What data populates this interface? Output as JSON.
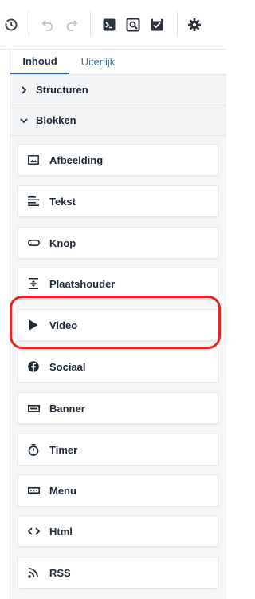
{
  "toolbar": {
    "icons": [
      "history-icon",
      "undo-icon",
      "redo-icon",
      "code-icon",
      "preview-icon",
      "save-icon",
      "settings-icon"
    ]
  },
  "tabs": [
    {
      "label": "Inhoud",
      "active": true
    },
    {
      "label": "Uiterlijk",
      "active": false
    }
  ],
  "sections": [
    {
      "label": "Structuren",
      "expanded": false
    },
    {
      "label": "Blokken",
      "expanded": true
    }
  ],
  "blocks": [
    {
      "label": "Afbeelding",
      "icon": "image-icon"
    },
    {
      "label": "Tekst",
      "icon": "text-icon"
    },
    {
      "label": "Knop",
      "icon": "button-icon"
    },
    {
      "label": "Plaatshouder",
      "icon": "spacer-icon"
    },
    {
      "label": "Video",
      "icon": "play-icon"
    },
    {
      "label": "Sociaal",
      "icon": "facebook-icon"
    },
    {
      "label": "Banner",
      "icon": "banner-icon"
    },
    {
      "label": "Timer",
      "icon": "timer-icon"
    },
    {
      "label": "Menu",
      "icon": "menu-icon"
    },
    {
      "label": "Html",
      "icon": "html-icon"
    },
    {
      "label": "RSS",
      "icon": "rss-icon"
    }
  ],
  "colors": {
    "accent": "#2b6cb0",
    "highlight": "#e8251f"
  }
}
